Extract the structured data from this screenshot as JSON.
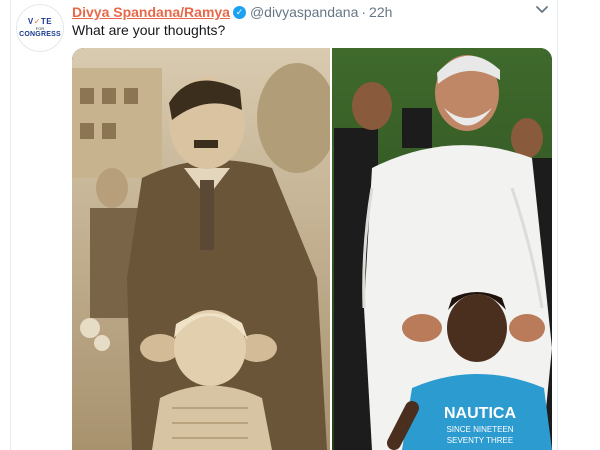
{
  "tweet": {
    "display_name": "Divya Spandana/Ramya",
    "handle": "@divyaspandana",
    "separator": "·",
    "timestamp": "22h",
    "text": "What are your thoughts?",
    "verified_icon": "verified-badge-icon",
    "menu_icon": "chevron-down-icon"
  },
  "avatar": {
    "line1_a": "V",
    "line1_check": "✓",
    "line1_b": "TE",
    "line2": "FOR",
    "line3": "CONGRESS"
  },
  "media": {
    "shirt_text_1": "NAUTICA",
    "shirt_text_2": "SINCE NINETEEN",
    "shirt_text_3": "SEVENTY THREE"
  },
  "colors": {
    "name": "#e8684a",
    "verified": "#1da1f2",
    "secondary_text": "#657786",
    "primary_text": "#14171a"
  }
}
